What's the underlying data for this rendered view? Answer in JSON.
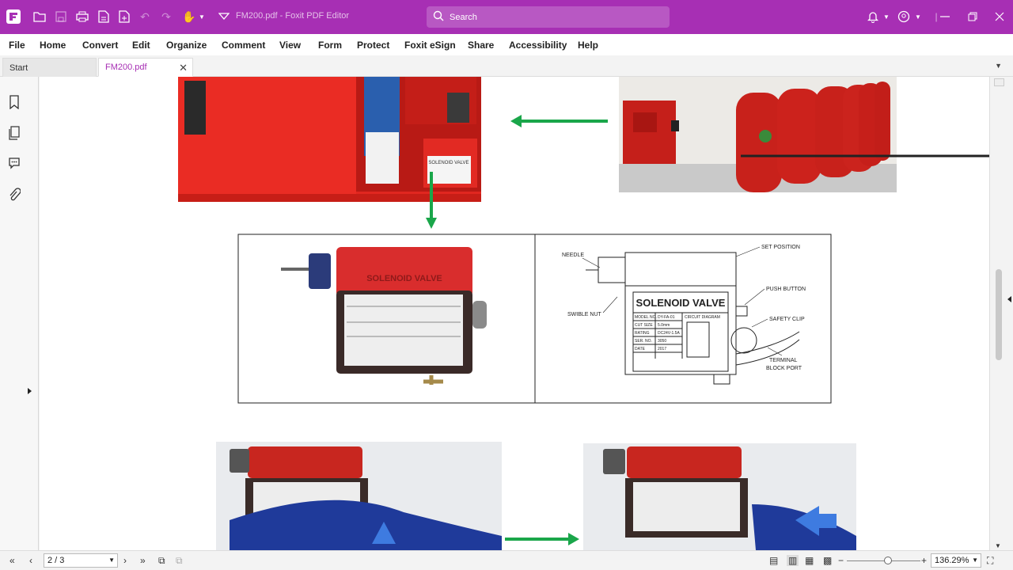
{
  "window": {
    "title": "FM200.pdf - Foxit PDF Editor"
  },
  "search": {
    "placeholder": "Search"
  },
  "menu": [
    "File",
    "Home",
    "Convert",
    "Edit",
    "Organize",
    "Comment",
    "View",
    "Form",
    "Protect",
    "Foxit eSign",
    "Share",
    "Accessibility",
    "Help"
  ],
  "tabs": {
    "start": "Start",
    "active": "FM200.pdf"
  },
  "diagram": {
    "valve_title": "SOLENOID VALVE",
    "embossed": "SOLENOID VALVE",
    "labels": {
      "needle": "NEEDLE",
      "swivel": "SWIBLE NUT",
      "set_position": "SET POSITION",
      "push_button": "PUSH BUTTON",
      "safety_clip": "SAFETY CLIP",
      "terminal": "TERMINAL",
      "block_port": "BLOCK PORT"
    },
    "plate": {
      "model_no": "MODEL NO.",
      "model_val": "DY-FA-01",
      "cut_size": "CUT SIZE",
      "cut_val": "5.0mm",
      "rating": "RATING",
      "rating_val": "DC24V-1.5A",
      "ser_no": "SER. NO.",
      "ser_val": "3050",
      "date": "DATE",
      "date_val": "2017",
      "circuit": "CIRCUIT DIAGRAM"
    }
  },
  "status": {
    "page": "2 / 3",
    "zoom": "136.29%"
  },
  "colors": {
    "brand": "#a72fb4",
    "arrow": "#1aa64a",
    "valve_red": "#d92d2d"
  }
}
